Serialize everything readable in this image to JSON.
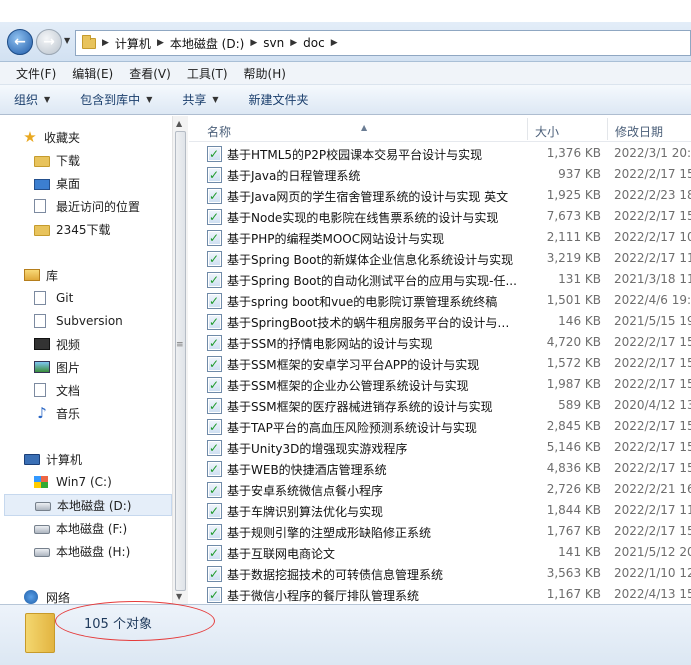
{
  "address": {
    "crumbs": [
      "计算机",
      "本地磁盘 (D:)",
      "svn",
      "doc"
    ]
  },
  "menu": [
    "文件(F)",
    "编辑(E)",
    "查看(V)",
    "工具(T)",
    "帮助(H)"
  ],
  "toolbar": {
    "organize": "组织",
    "include": "包含到库中",
    "share": "共享",
    "new_folder": "新建文件夹"
  },
  "sidebar": {
    "favorites": {
      "label": "收藏夹",
      "items": [
        "下载",
        "桌面",
        "最近访问的位置",
        "2345下载"
      ]
    },
    "libraries": {
      "label": "库",
      "items": [
        "Git",
        "Subversion",
        "视频",
        "图片",
        "文档",
        "音乐"
      ]
    },
    "computer": {
      "label": "计算机",
      "items": [
        "Win7 (C:)",
        "本地磁盘 (D:)",
        "本地磁盘 (F:)",
        "本地磁盘 (H:)"
      ]
    },
    "network": {
      "label": "网络"
    }
  },
  "columns": {
    "name": "名称",
    "size": "大小",
    "date": "修改日期"
  },
  "files": [
    {
      "name": "基于HTML5的P2P校园课本交易平台设计与实现",
      "size": "1,376 KB",
      "date": "2022/3/1 20:0"
    },
    {
      "name": "基于Java的日程管理系统",
      "size": "937 KB",
      "date": "2022/2/17 15"
    },
    {
      "name": "基于Java网页的学生宿舍管理系统的设计与实现 英文",
      "size": "1,925 KB",
      "date": "2022/2/23 18"
    },
    {
      "name": "基于Node实现的电影院在线售票系统的设计与实现",
      "size": "7,673 KB",
      "date": "2022/2/17 15"
    },
    {
      "name": "基于PHP的编程类MOOC网站设计与实现",
      "size": "2,111 KB",
      "date": "2022/2/17 10"
    },
    {
      "name": "基于Spring Boot的新媒体企业信息化系统设计与实现",
      "size": "3,219 KB",
      "date": "2022/2/17 11"
    },
    {
      "name": "基于Spring Boot的自动化测试平台的应用与实现-任...",
      "size": "131 KB",
      "date": "2021/3/18 11"
    },
    {
      "name": "基于spring boot和vue的电影院订票管理系统终稿",
      "size": "1,501 KB",
      "date": "2022/4/6 19:3"
    },
    {
      "name": "基于SpringBoot技术的蜗牛租房服务平台的设计与实...",
      "size": "146 KB",
      "date": "2021/5/15 19"
    },
    {
      "name": "基于SSM的抒情电影网站的设计与实现",
      "size": "4,720 KB",
      "date": "2022/2/17 15"
    },
    {
      "name": "基于SSM框架的安卓学习平台APP的设计与实现",
      "size": "1,572 KB",
      "date": "2022/2/17 15"
    },
    {
      "name": "基于SSM框架的企业办公管理系统设计与实现",
      "size": "1,987 KB",
      "date": "2022/2/17 15"
    },
    {
      "name": "基于SSM框架的医疗器械进销存系统的设计与实现",
      "size": "589 KB",
      "date": "2020/4/12 13"
    },
    {
      "name": "基于TAP平台的高血压风险预测系统设计与实现",
      "size": "2,845 KB",
      "date": "2022/2/17 15"
    },
    {
      "name": "基于Unity3D的增强现实游戏程序",
      "size": "5,146 KB",
      "date": "2022/2/17 15"
    },
    {
      "name": "基于WEB的快捷酒店管理系统",
      "size": "4,836 KB",
      "date": "2022/2/17 15"
    },
    {
      "name": "基于安卓系统微信点餐小程序",
      "size": "2,726 KB",
      "date": "2022/2/21 16"
    },
    {
      "name": "基于车牌识别算法优化与实现",
      "size": "1,844 KB",
      "date": "2022/2/17 11"
    },
    {
      "name": "基于规则引擎的注塑成形缺陷修正系统",
      "size": "1,767 KB",
      "date": "2022/2/17 15"
    },
    {
      "name": "基于互联网电商论文",
      "size": "141 KB",
      "date": "2021/5/12 20"
    },
    {
      "name": "基于数据挖掘技术的可转债信息管理系统",
      "size": "3,563 KB",
      "date": "2022/1/10 12"
    },
    {
      "name": "基于微信小程序的餐厅排队管理系统",
      "size": "1,167 KB",
      "date": "2022/4/13 15"
    }
  ],
  "status": {
    "count": "105 个对象"
  }
}
